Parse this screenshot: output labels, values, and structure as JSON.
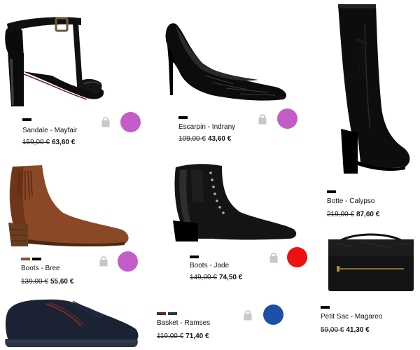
{
  "products": [
    {
      "id": "mayfair",
      "name": "Sandale - Mayfair",
      "old_price": "159,00 €",
      "new_price": "63,60 €",
      "swatches": [
        "#000000"
      ],
      "dot_color": "#c45cc7",
      "image_icon": "black-patent-t-bar-heeled-sandal"
    },
    {
      "id": "indrany",
      "name": "Escarpin - Indrany",
      "old_price": "109,00 €",
      "new_price": "43,60 €",
      "swatches": [
        "#000000"
      ],
      "dot_color": "#c45cc7",
      "image_icon": "black-croc-pump"
    },
    {
      "id": "calypso",
      "name": "Botte - Calypso",
      "old_price": "219,00 €",
      "new_price": "87,60 €",
      "swatches": [
        "#000000"
      ],
      "image_icon": "black-knee-high-boot"
    },
    {
      "id": "bree",
      "name": "Boots - Bree",
      "old_price": "139,00 €",
      "new_price": "55,60 €",
      "swatches": [
        "#8a4e2c",
        "#000000"
      ],
      "dot_color": "#c45cc7",
      "image_icon": "brown-suede-fringe-ankle-boot"
    },
    {
      "id": "jade",
      "name": "Boots - Jade",
      "old_price": "149,00 €",
      "new_price": "74,50 €",
      "swatches": [
        "#000000"
      ],
      "dot_color": "#ee1111",
      "image_icon": "black-studded-ankle-boot"
    },
    {
      "id": "magareo",
      "name": "Petit Sac - Magareo",
      "old_price": "59,00 €",
      "new_price": "41,30 €",
      "swatches": [
        "#000000"
      ],
      "image_icon": "black-croc-clutch-bag"
    },
    {
      "id": "ramses",
      "name": "Basket - Ramses",
      "old_price": "119,00 €",
      "new_price": "71,40 €",
      "swatches": [
        "#5a2630",
        "#2b3550"
      ],
      "dot_color": "#1b4fa8",
      "image_icon": "navy-leather-sneaker"
    }
  ],
  "icons": {
    "bag": "shopping-bag-icon"
  }
}
